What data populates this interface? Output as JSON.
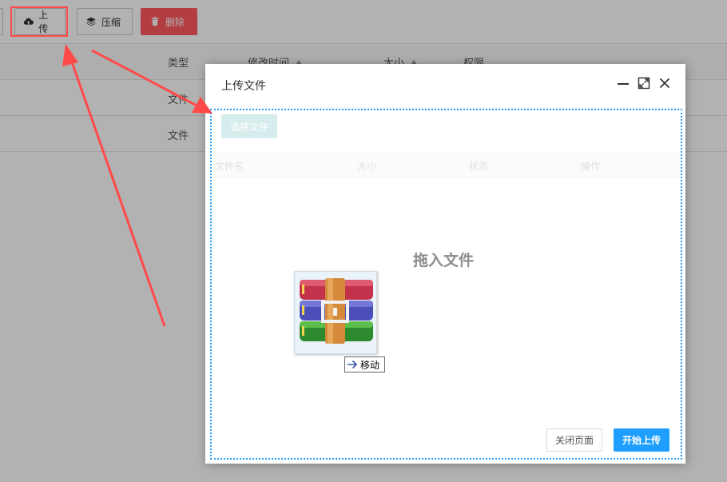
{
  "toolbar": {
    "upload_label": "上传",
    "compress_label": "压缩",
    "delete_label": "删除"
  },
  "table": {
    "headers": {
      "type": "类型",
      "modified": "修改时间",
      "size": "大小",
      "permission": "权限"
    },
    "rows": [
      {
        "type": "文件"
      },
      {
        "type": "文件"
      }
    ]
  },
  "modal": {
    "title": "上传文件",
    "pick_files_label": "选择文件",
    "file_table_headers": {
      "name": "文件名",
      "size": "大小",
      "status": "状态",
      "action": "操作"
    },
    "drop_label": "拖入文件",
    "drag_tip": "移动",
    "close_page_label": "关闭页面",
    "start_upload_label": "开始上传"
  },
  "colors": {
    "accent": "#1e9fff",
    "danger": "#ff5a5f",
    "annotation": "#ff4a4a"
  },
  "icons": {
    "upload": "cloud-upload-icon",
    "compress": "layers-icon",
    "delete": "trash-icon",
    "dragged_file": "winrar-archive-icon"
  }
}
